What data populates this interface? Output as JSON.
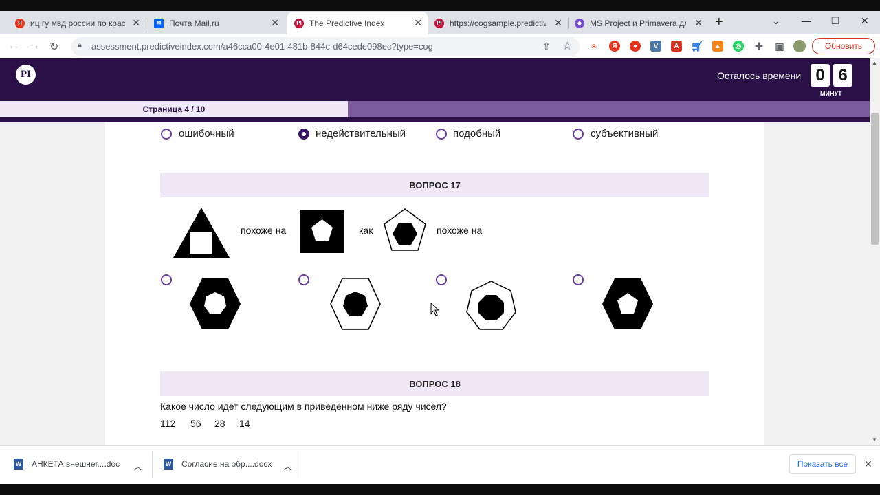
{
  "browser": {
    "tabs": [
      {
        "title": "иц гу мвд россии по красно",
        "favicon_color": "#e8341c",
        "favicon_glyph": "Я"
      },
      {
        "title": "Почта Mail.ru",
        "favicon_color": "#005ff9",
        "favicon_glyph": "✉"
      },
      {
        "title": "The Predictive Index",
        "favicon_color": "#c0143c",
        "favicon_glyph": "PI"
      },
      {
        "title": "https://cogsample.predictive",
        "favicon_color": "#c0143c",
        "favicon_glyph": "PI"
      },
      {
        "title": "MS Project и Primavera для у",
        "favicon_color": "#7a4fd0",
        "favicon_glyph": "◆"
      }
    ],
    "active_tab": 2,
    "url": "assessment.predictiveindex.com/a46cca00-4e01-481b-844c-d64cede098ec?type=cog",
    "update_button": "Обновить"
  },
  "header": {
    "logo_text": "PI",
    "time_label": "Осталось времени",
    "time_digits": [
      "0",
      "6"
    ],
    "time_unit": "МИНУТ"
  },
  "progress": {
    "label": "Страница 4 / 10",
    "fraction": 0.4
  },
  "q16": {
    "options": [
      "ошибочный",
      "недействительный",
      "подобный",
      "субъективный"
    ],
    "selected_index": 1
  },
  "q17": {
    "heading": "ВОПРОС 17",
    "phrase_1": "похоже на",
    "phrase_2": "как",
    "phrase_3": "похоже на"
  },
  "q18": {
    "heading": "ВОПРОС 18",
    "question": "Какое число идет следующим в приведенном ниже ряду чисел?",
    "sequence": [
      "112",
      "56",
      "28",
      "14"
    ]
  },
  "downloads": {
    "items": [
      {
        "name": "АНКЕТА внешнег....doc"
      },
      {
        "name": "Согласие на обр....docx"
      }
    ],
    "show_all": "Показать все"
  }
}
